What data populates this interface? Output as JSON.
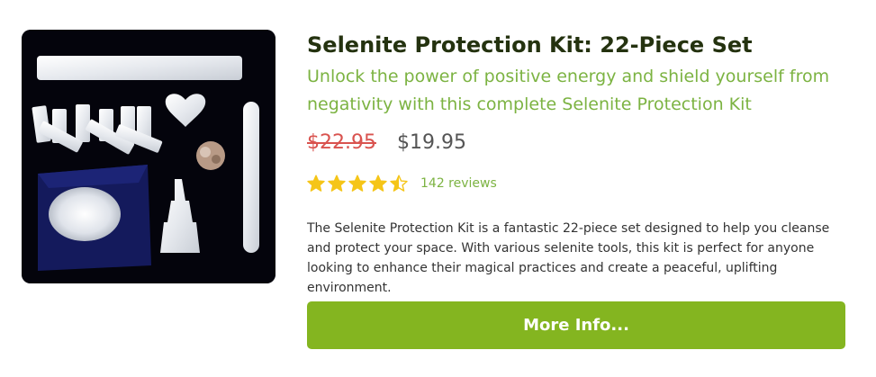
{
  "product": {
    "image_alt": "Selenite protection kit crystals on black background",
    "title": "Selenite Protection Kit: 22-Piece Set",
    "subtitle": "Unlock the power of positive energy and shield yourself from negativity with this complete Selenite Protection Kit",
    "price": {
      "original": "$22.95",
      "sale": "$19.95"
    },
    "rating": {
      "value": 4.5,
      "max": 5,
      "reviews_label": "142 reviews"
    },
    "description": "The Selenite Protection Kit is a fantastic 22-piece set designed to help you cleanse and protect your space. With various selenite tools, this kit is perfect for anyone looking to enhance their magical practices and create a peaceful, uplifting environment.",
    "cta_label": "More Info..."
  },
  "colors": {
    "title": "#24320f",
    "accent_green": "#7cb342",
    "button_bg": "#84b520",
    "old_price": "#d9534f",
    "star": "#f5c518"
  }
}
